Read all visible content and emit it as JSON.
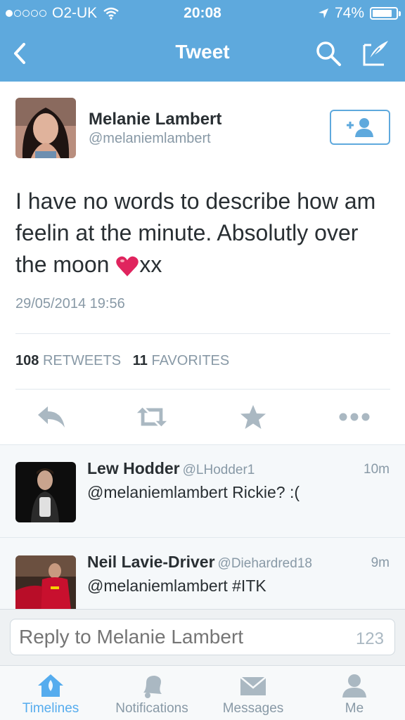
{
  "status_bar": {
    "carrier": "O2-UK",
    "time": "20:08",
    "battery": "74%",
    "battery_level": 0.74,
    "signal_dots_filled": 1
  },
  "navbar": {
    "title": "Tweet",
    "icons": [
      "back-chevron-icon",
      "search-icon",
      "compose-icon"
    ]
  },
  "tweet": {
    "author_name": "Melanie Lambert",
    "author_handle": "@melaniemlambert",
    "text_main": "I have no words to describe how am feelin at the minute. Absolutly over the moon ",
    "text_end": "xx",
    "date": "29/05/2014 19:56",
    "retweets_count": "108",
    "retweets_label": "RETWEETS",
    "favorites_count": "11",
    "favorites_label": "FAVORITES"
  },
  "replies": [
    {
      "name": "Lew Hodder",
      "handle": "@LHodder1",
      "time": "10m",
      "text": "@melaniemlambert Rickie? :("
    },
    {
      "name": "Neil Lavie-Driver",
      "handle": "@Diehardred18",
      "time": "9m",
      "text": "@melaniemlambert #ITK"
    }
  ],
  "reply_bar": {
    "placeholder": "Reply to Melanie Lambert",
    "char_count": "123"
  },
  "tabs": [
    {
      "label": "Timelines",
      "icon": "home-icon",
      "active": true
    },
    {
      "label": "Notifications",
      "icon": "bell-icon",
      "active": false
    },
    {
      "label": "Messages",
      "icon": "envelope-icon",
      "active": false
    },
    {
      "label": "Me",
      "icon": "person-icon",
      "active": false
    }
  ],
  "colors": {
    "brand_blue": "#5ea9dd",
    "active_tab": "#55acee",
    "muted": "#8899a6",
    "heart": "#e0245e"
  }
}
